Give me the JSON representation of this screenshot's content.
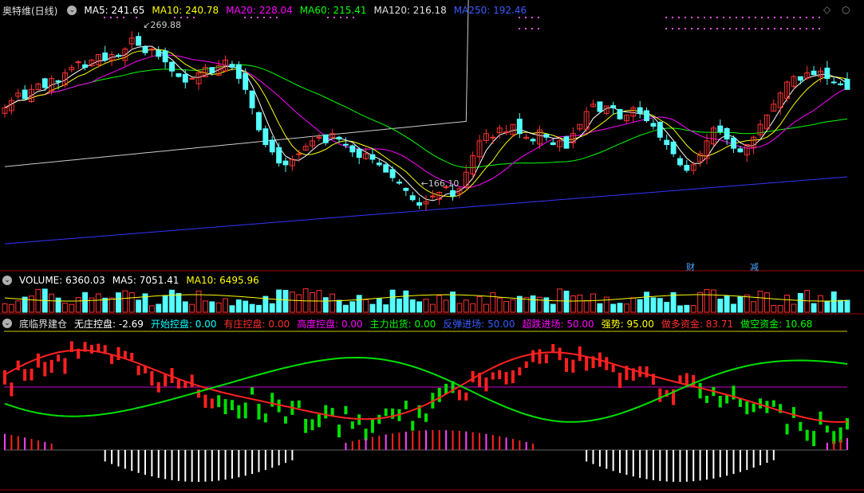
{
  "main_legend": {
    "title": "奥特维(日线)",
    "ma5": "MA5: 241.65",
    "ma10": "MA10: 240.78",
    "ma20": "MA20: 228.04",
    "ma60": "MA60: 215.41",
    "ma120": "MA120: 216.18",
    "ma250": "MA250: 192.46"
  },
  "annotations": {
    "high": "269.88",
    "low": "166.10",
    "tag_cai": "财",
    "tag_jian": "减"
  },
  "volume_legend": {
    "volume": "VOLUME: 6360.03",
    "ma5": "MA5: 7051.41",
    "ma10": "MA10: 6495.96"
  },
  "indicator_legend": {
    "name": "底临界建仓",
    "wuzhuang": "无庄控盘: -2.69",
    "kaishi": "开始控盘: 0.00",
    "youzhuang": "有庄控盘: 0.00",
    "gaodu": "高度控盘: 0.00",
    "zhuli": "主力出货: 0.00",
    "fantan": "反弹进场: 50.00",
    "chaodie": "超跌进场: 50.00",
    "qiangshi": "强势: 95.00",
    "zuoduo": "做多资金: 83.71",
    "zuokong": "做空资金: 10.68"
  },
  "colors": {
    "up": "#ff3232",
    "down": "#54ffff",
    "ma5": "#ffffff",
    "ma10": "#ffff00",
    "ma20": "#ff00ff",
    "ma60": "#00ff00",
    "ma120": "#cccccc",
    "ma250": "#3333ff",
    "ind_green": "#00e000",
    "ind_red": "#ff2020"
  },
  "icons": [
    "collapse-icon",
    "diamond-icon",
    "circle-icon"
  ],
  "chart_data": {
    "type": "candlestick",
    "price_range": [
      150,
      280
    ],
    "high": 269.88,
    "low": 166.1,
    "last_values": {
      "ma5": 241.65,
      "ma10": 240.78,
      "ma20": 228.04,
      "ma60": 215.41,
      "ma120": 216.18,
      "ma250": 192.46,
      "volume": 6360.03,
      "vol_ma5": 7051.41,
      "vol_ma10": 6495.96
    },
    "close": [
      230,
      234,
      238,
      235,
      240,
      243,
      241,
      246,
      244,
      249,
      252,
      255,
      252,
      256,
      259,
      256,
      259,
      258,
      262,
      268,
      264,
      260,
      262,
      258,
      255,
      250,
      247,
      244,
      246,
      249,
      252,
      249,
      253,
      256,
      252,
      246,
      240,
      230,
      218,
      210,
      206,
      200,
      199,
      202,
      205,
      209,
      212,
      214,
      211,
      216,
      213,
      210,
      206,
      203,
      205,
      202,
      199,
      195,
      192,
      189,
      185,
      180,
      177,
      179,
      182,
      184,
      187,
      182,
      186,
      195,
      204,
      212,
      216,
      214,
      219,
      217,
      221,
      216,
      214,
      212,
      218,
      214,
      210,
      212,
      208,
      216,
      221,
      228,
      232,
      228,
      231,
      230,
      224,
      226,
      230,
      227,
      223,
      220,
      214,
      210,
      205,
      199,
      196,
      199,
      205,
      212,
      219,
      217,
      213,
      208,
      206,
      210,
      214,
      221,
      226,
      232,
      238,
      244,
      247,
      245,
      249,
      248,
      250,
      246,
      244,
      243,
      240
    ]
  }
}
